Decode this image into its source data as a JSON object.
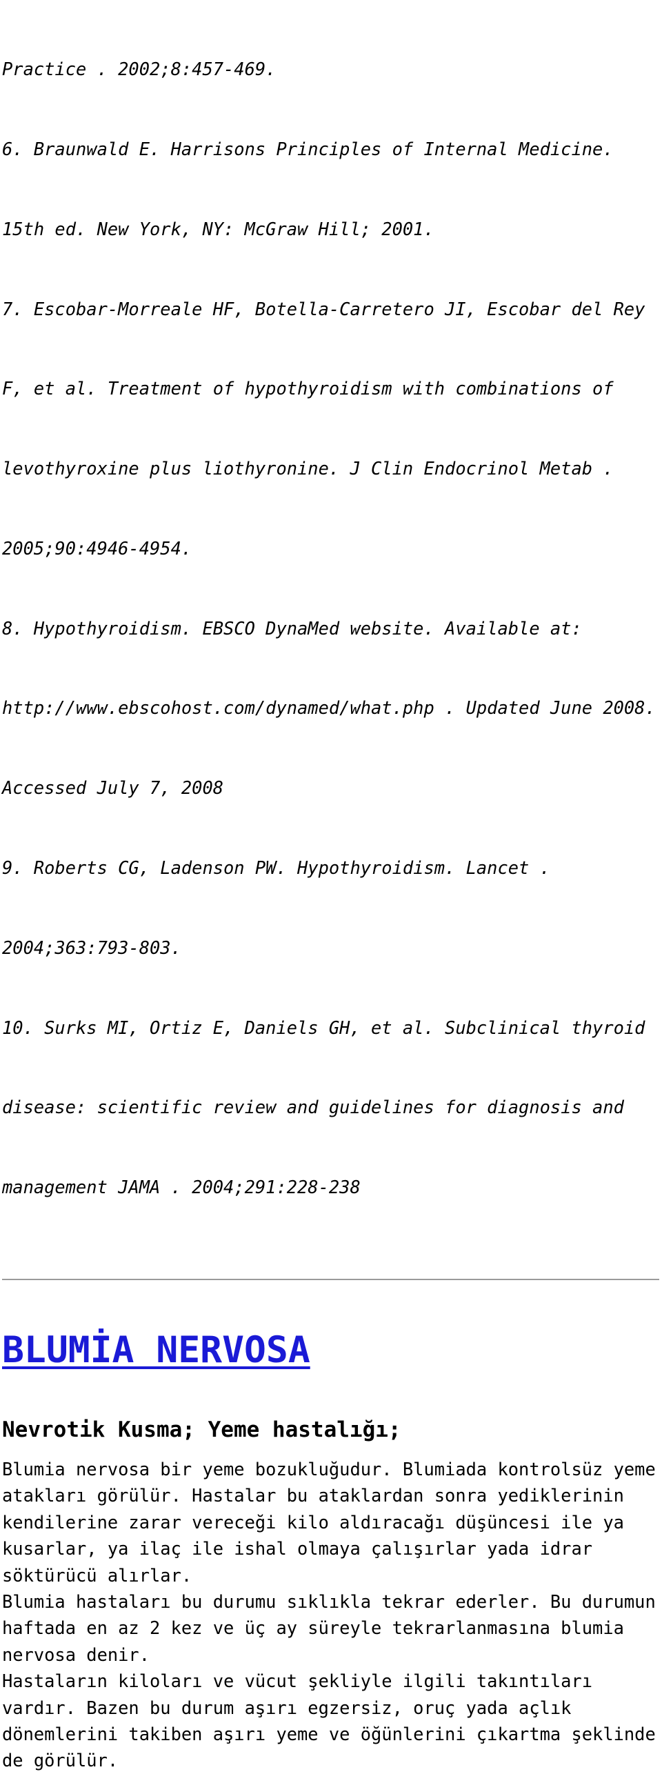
{
  "document": {
    "references_section": {
      "lines": [
        "Practice . 2002;8:457-469.",
        "6. Braunwald E. Harrisons Principles of Internal Medicine.",
        "15th ed. New York, NY: McGraw Hill; 2001.",
        "7. Escobar-Morreale HF, Botella-Carretero JI, Escobar del Rey",
        "F, et al. Treatment of hypothyroidism with combinations of",
        "levothyroxine plus liothyronine. J Clin Endocrinol Metab .",
        "2005;90:4946-4954.",
        "8. Hypothyroidism. EBSCO DynaMed website. Available at:",
        "http://www.ebscohost.com/dynamed/what.php . Updated June 2008.",
        "Accessed July 7, 2008",
        "9. Roberts CG, Ladenson PW. Hypothyroidism. Lancet .",
        "2004;363:793-803.",
        "10. Surks MI, Ortiz E, Daniels GH, et al. Subclinical thyroid",
        "disease: scientific review and guidelines for diagnosis and",
        "management JAMA . 2004;291:228-238"
      ]
    },
    "divider": {
      "color": "#9a9a9a"
    },
    "main_heading": {
      "text": "BLUMİA NERVOSA",
      "color": "#1a1ad6"
    },
    "sub_heading": {
      "text": "Nevrotik Kusma; Yeme hastalığı;"
    },
    "body": {
      "paragraph_1": [
        "Blumia nervosa bir yeme bozukluğudur. Blumiada kontrolsüz yeme",
        "atakları görülür. Hastalar bu ataklardan sonra yediklerinin",
        "kendilerine zarar vereceği kilo aldıracağı düşüncesi ile ya",
        "kusarlar, ya ilaç ile ishal olmaya çalışırlar yada idrar",
        "söktürücü alırlar."
      ],
      "paragraph_2": [
        "Blumia hastaları bu durumu sıklıkla tekrar ederler. Bu durumun",
        "haftada en az 2 kez ve üç ay süreyle tekrarlanmasına blumia",
        "nervosa denir."
      ],
      "paragraph_3": [
        "Hastaların kiloları ve vücut şekliyle ilgili takıntıları",
        "vardır. Bazen bu durum aşırı egzersiz, oruç yada açlık",
        "dönemlerini takiben aşırı yeme ve öğünlerini çıkartma şeklinde",
        "de görülür."
      ]
    }
  }
}
